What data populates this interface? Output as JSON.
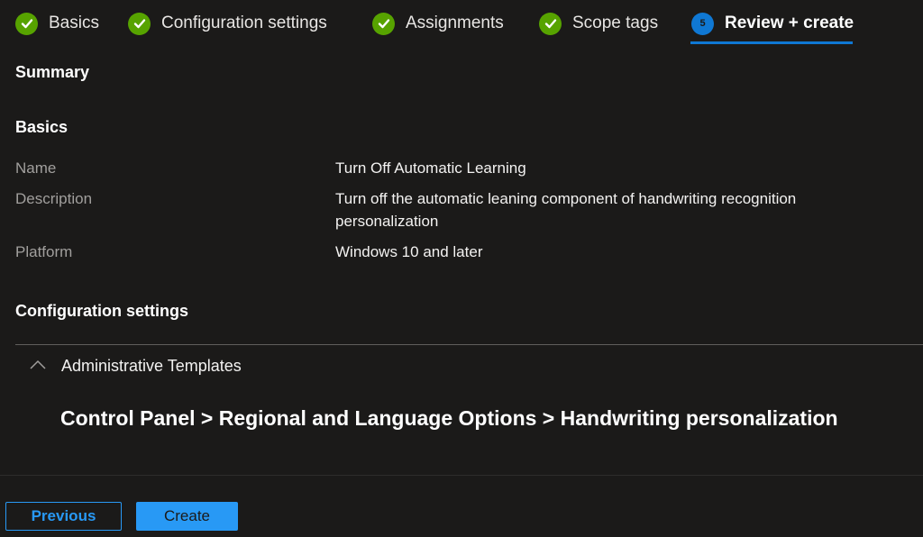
{
  "wizard": {
    "steps": [
      {
        "label": "Basics",
        "status": "complete",
        "icon": "check-icon"
      },
      {
        "label": "Configuration settings",
        "status": "complete",
        "icon": "check-icon"
      },
      {
        "label": "Assignments",
        "status": "complete",
        "icon": "check-icon"
      },
      {
        "label": "Scope tags",
        "status": "complete",
        "icon": "check-icon"
      },
      {
        "label": "Review + create",
        "status": "current",
        "number": "5"
      }
    ]
  },
  "summary": {
    "title": "Summary",
    "basics": {
      "title": "Basics",
      "fields": [
        {
          "key": "Name",
          "value": "Turn Off Automatic Learning"
        },
        {
          "key": "Description",
          "value": "Turn off the automatic leaning component of handwriting recognition personalization"
        },
        {
          "key": "Platform",
          "value": "Windows 10 and later"
        }
      ]
    },
    "config": {
      "title": "Configuration settings",
      "accordion_label": "Administrative Templates",
      "accordion_state": "expanded",
      "path": "Control Panel > Regional and Language Options > Handwriting personalization"
    }
  },
  "footer": {
    "previous_label": "Previous",
    "create_label": "Create"
  },
  "colors": {
    "complete": "#57a300",
    "accent": "#0f78d4",
    "button": "#2899f5"
  }
}
